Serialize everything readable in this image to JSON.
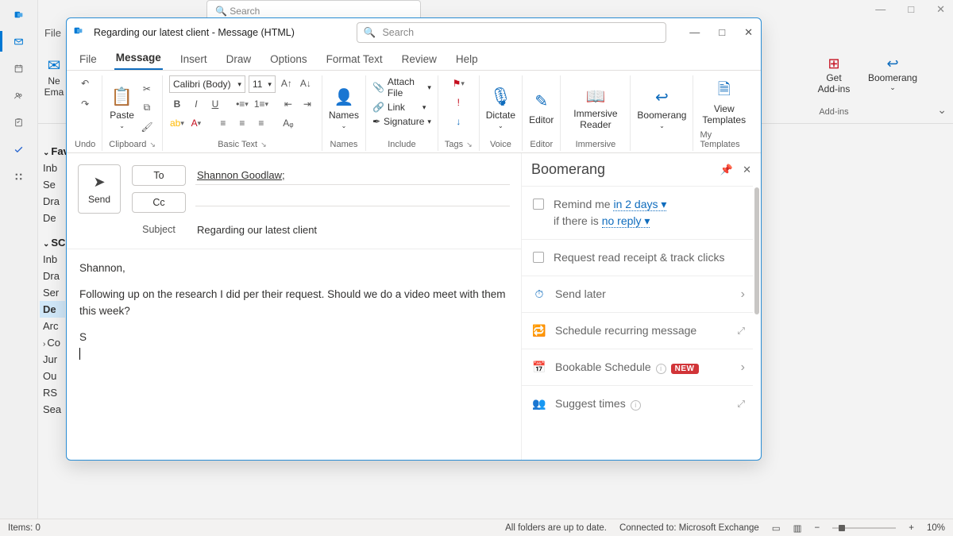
{
  "main_window": {
    "search_placeholder": "Search",
    "file_menu": "File",
    "new_email": {
      "line1": "Ne",
      "line2": "Ema"
    },
    "get_addins": {
      "line1": "Get",
      "line2": "Add-ins",
      "label": "Add-ins"
    },
    "boomerang": "Boomerang",
    "wincontrols": {
      "minimize": "—",
      "maximize": "□",
      "close": "✕"
    }
  },
  "left_rail": [
    "outlook-app-icon",
    "mail-icon",
    "calendar-icon",
    "people-icon",
    "tasks-icon",
    "todo-icon",
    "more-apps-icon"
  ],
  "folders": {
    "favorites_label": "Favorites",
    "favorites": [
      "Inb",
      "Se",
      "Dra",
      "De"
    ],
    "account_label": "SCO",
    "account": [
      "Inb",
      "Dra",
      "Ser",
      "De",
      "Arc",
      "Co",
      "Jur",
      "Ou",
      "RS",
      "Sea"
    ]
  },
  "compose": {
    "title": "Regarding our latest client  -  Message (HTML)",
    "search_placeholder": "Search",
    "wincontrols": {
      "minimize": "—",
      "maximize": "□",
      "close": "✕"
    },
    "tabs": [
      "File",
      "Message",
      "Insert",
      "Draw",
      "Options",
      "Format Text",
      "Review",
      "Help"
    ],
    "active_tab": "Message",
    "ribbon": {
      "undo": {
        "label": "Undo"
      },
      "clipboard": {
        "paste": "Paste",
        "label": "Clipboard"
      },
      "basic_text": {
        "font": "Calibri (Body)",
        "size": "11",
        "label": "Basic Text"
      },
      "names": {
        "btn": "Names",
        "label": "Names"
      },
      "include": {
        "attach": "Attach File",
        "link": "Link",
        "signature": "Signature",
        "label": "Include"
      },
      "tags": {
        "label": "Tags"
      },
      "voice": {
        "btn": "Dictate",
        "label": "Voice"
      },
      "editor": {
        "btn": "Editor",
        "label": "Editor"
      },
      "immersive": {
        "btn": "Immersive\nReader",
        "label": "Immersive"
      },
      "boomerang": {
        "btn": "Boomerang"
      },
      "templates": {
        "btn": "View\nTemplates",
        "label": "My Templates"
      }
    },
    "envelope": {
      "send": "Send",
      "to_label": "To",
      "to_value": "Shannon Goodlaw;",
      "cc_label": "Cc",
      "cc_value": "",
      "subject_label": "Subject",
      "subject_value": "Regarding our latest client"
    },
    "body": {
      "greeting": "Shannon,",
      "para1": "Following up on the research I did per their request. Should we do a video meet with them this week?",
      "sig": "S"
    }
  },
  "boomerang_pane": {
    "title": "Boomerang",
    "items": {
      "remind": {
        "prefix": "Remind me ",
        "when": "in 2 days",
        "cond_prefix": "if there is ",
        "cond": "no reply"
      },
      "receipt": "Request read receipt & track clicks",
      "send_later": "Send later",
      "recurring": "Schedule recurring message",
      "bookable": "Bookable Schedule",
      "new_badge": "NEW",
      "suggest": "Suggest times"
    }
  },
  "statusbar": {
    "items": "Items: 0",
    "folders_status": "All folders are up to date.",
    "connected": "Connected to: Microsoft Exchange",
    "zoom": "10%"
  }
}
